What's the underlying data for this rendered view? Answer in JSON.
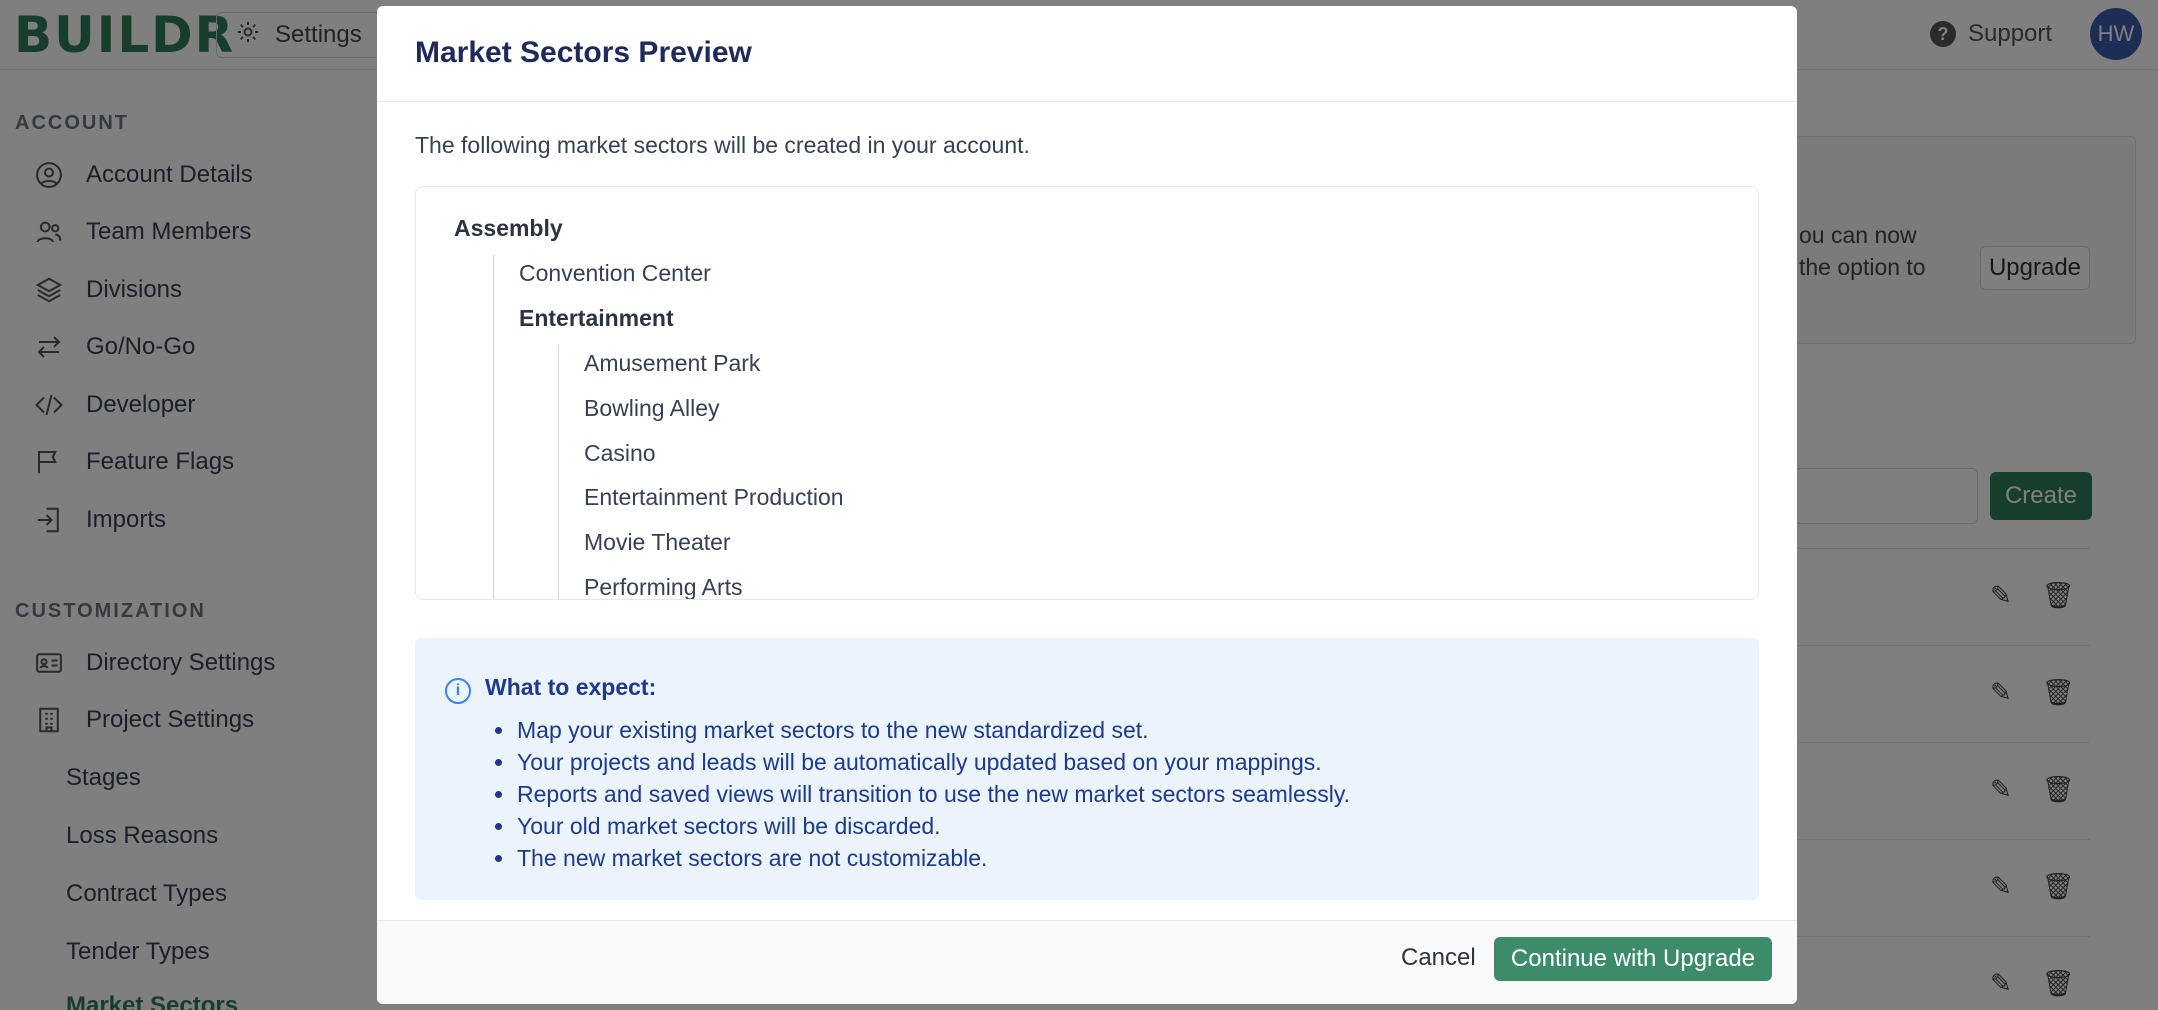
{
  "app": {
    "logo": "BUILDR",
    "settings_label": "Settings",
    "support_label": "Support",
    "avatar_initials": "HW"
  },
  "sidebar": {
    "account_title": "ACCOUNT",
    "account_items": [
      {
        "label": "Account Details",
        "icon": "user-circle-icon"
      },
      {
        "label": "Team Members",
        "icon": "users-icon"
      },
      {
        "label": "Divisions",
        "icon": "layers-icon"
      },
      {
        "label": "Go/No-Go",
        "icon": "arrows-icon"
      },
      {
        "label": "Developer",
        "icon": "code-icon"
      },
      {
        "label": "Feature Flags",
        "icon": "flag-icon"
      },
      {
        "label": "Imports",
        "icon": "import-icon"
      }
    ],
    "customization_title": "CUSTOMIZATION",
    "customization_items": [
      {
        "label": "Directory Settings",
        "icon": "id-card-icon"
      },
      {
        "label": "Project Settings",
        "icon": "building-icon"
      }
    ],
    "project_sub_items": [
      "Stages",
      "Loss Reasons",
      "Contract Types",
      "Tender Types",
      "Market Sectors"
    ]
  },
  "background": {
    "card_text_1": "ou can now",
    "card_text_2": " the option to",
    "upgrade_label": "Upgrade",
    "create_label": "Create"
  },
  "modal": {
    "title": "Market Sectors Preview",
    "intro": "The following market sectors will be created in your account.",
    "tree": {
      "root": "Assembly",
      "level1": [
        "Convention Center",
        "Entertainment"
      ],
      "level2": [
        "Amusement Park",
        "Bowling Alley",
        "Casino",
        "Entertainment Production",
        "Movie Theater",
        "Performing Arts"
      ]
    },
    "info": {
      "title": "What to expect:",
      "items": [
        "Map your existing market sectors to the new standardized set.",
        "Your projects and leads will be automatically updated based on your mappings.",
        "Reports and saved views will transition to use the new market sectors seamlessly.",
        "Your old market sectors will be discarded.",
        "The new market sectors are not customizable."
      ]
    },
    "cancel_label": "Cancel",
    "continue_label": "Continue with Upgrade"
  },
  "colors": {
    "brand_green": "#2e7d5b",
    "primary_button": "#3c8c6a",
    "info_bg": "#ebf3fd",
    "info_text": "#1e3a8a",
    "title_navy": "#1f2a5a"
  }
}
